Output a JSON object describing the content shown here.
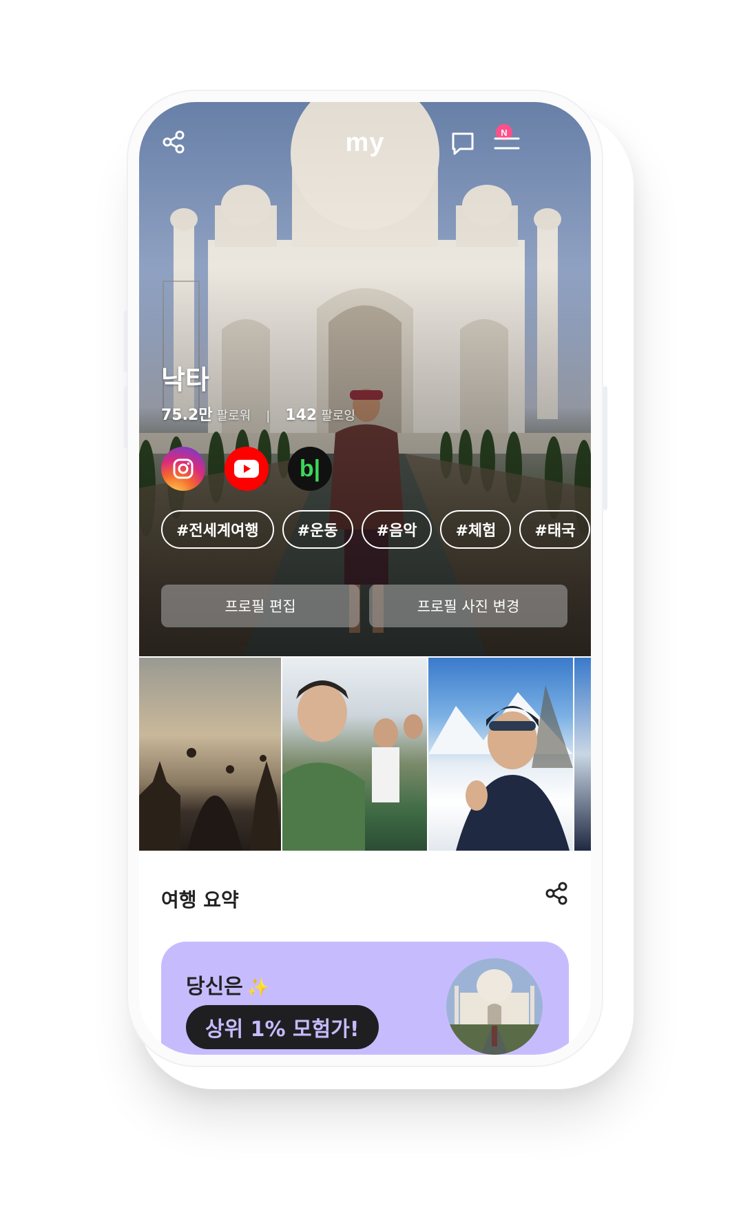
{
  "app": {
    "logo": "my"
  },
  "header": {
    "notification_badge": "N"
  },
  "profile": {
    "name": "낙타",
    "followers_value": "75.2만",
    "followers_label": "팔로워",
    "separator": "|",
    "following_value": "142",
    "following_label": "팔로잉"
  },
  "socials": [
    {
      "icon": "instagram-icon"
    },
    {
      "icon": "youtube-icon"
    },
    {
      "icon": "blog-icon",
      "glyph": "b|"
    }
  ],
  "tags": [
    "#전세계여행",
    "#운동",
    "#음악",
    "#체험",
    "#태국"
  ],
  "actions": {
    "edit_profile": "프로필 편집",
    "change_photo": "프로필 사진 변경"
  },
  "summary": {
    "title": "여행 요약",
    "card_line1": "당신은",
    "card_sparkle": "✨",
    "card_highlight": "상위 1% 모험가!"
  },
  "colors": {
    "accent": "#c6bcfd",
    "badge": "#ff4f8b",
    "pill_bg": "#1f1f22"
  }
}
